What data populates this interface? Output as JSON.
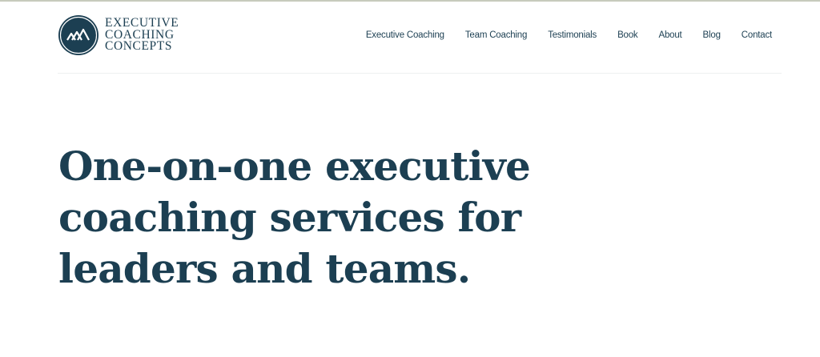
{
  "brand": {
    "lines": [
      "EXECUTIVE",
      "COACHING",
      "CONCEPTS"
    ]
  },
  "nav": {
    "items": [
      {
        "label": "Executive Coaching"
      },
      {
        "label": "Team Coaching"
      },
      {
        "label": "Testimonials"
      },
      {
        "label": "Book"
      },
      {
        "label": "About"
      },
      {
        "label": "Blog"
      },
      {
        "label": "Contact"
      }
    ]
  },
  "hero": {
    "lines": [
      "One-on-one executive",
      "coaching services for",
      "leaders and teams."
    ]
  },
  "colors": {
    "brand_navy": "#1c3f52",
    "background": "#ffffff",
    "top_rule": "#c7cbbc"
  }
}
